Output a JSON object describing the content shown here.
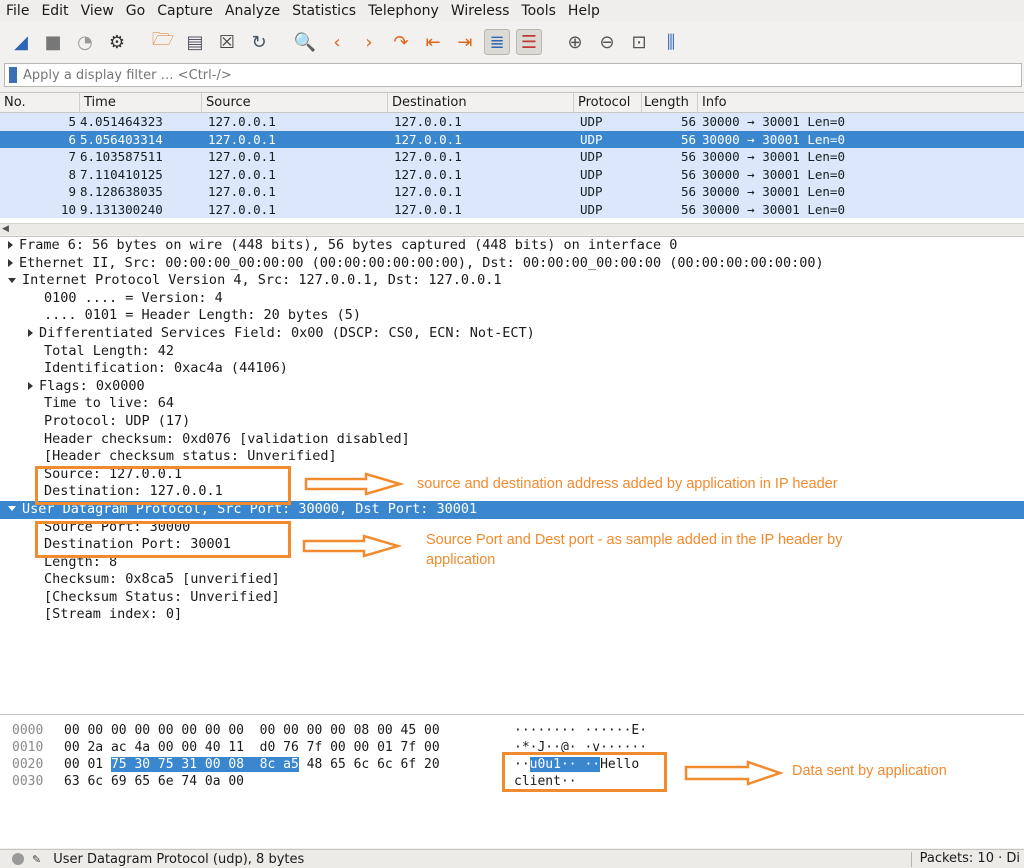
{
  "menu": [
    "File",
    "Edit",
    "View",
    "Go",
    "Capture",
    "Analyze",
    "Statistics",
    "Telephony",
    "Wireless",
    "Tools",
    "Help"
  ],
  "toolbar": [
    "shark-fin-start-icon",
    "stop-icon",
    "restart-icon",
    "options-gear-icon",
    "open-folder-icon",
    "save-file-icon",
    "close-file-icon",
    "reload-icon",
    "find-icon",
    "go-back-icon",
    "go-forward-icon",
    "go-to-packet-icon",
    "first-packet-icon",
    "last-packet-icon",
    "autoscroll-icon",
    "colorize-icon",
    "zoom-in-icon",
    "zoom-out-icon",
    "normal-size-icon",
    "resize-columns-icon"
  ],
  "filter": {
    "placeholder": "Apply a display filter … <Ctrl-/>"
  },
  "packet_list": {
    "columns": [
      "No.",
      "Time",
      "Source",
      "Destination",
      "Protocol",
      "Length",
      "Info"
    ],
    "rows": [
      {
        "no": "5",
        "time": "4.051464323",
        "src": "127.0.0.1",
        "dst": "127.0.0.1",
        "proto": "UDP",
        "len": "56",
        "info": "30000 → 30001 Len=0"
      },
      {
        "no": "6",
        "time": "5.056403314",
        "src": "127.0.0.1",
        "dst": "127.0.0.1",
        "proto": "UDP",
        "len": "56",
        "info": "30000 → 30001 Len=0"
      },
      {
        "no": "7",
        "time": "6.103587511",
        "src": "127.0.0.1",
        "dst": "127.0.0.1",
        "proto": "UDP",
        "len": "56",
        "info": "30000 → 30001 Len=0"
      },
      {
        "no": "8",
        "time": "7.110410125",
        "src": "127.0.0.1",
        "dst": "127.0.0.1",
        "proto": "UDP",
        "len": "56",
        "info": "30000 → 30001 Len=0"
      },
      {
        "no": "9",
        "time": "8.128638035",
        "src": "127.0.0.1",
        "dst": "127.0.0.1",
        "proto": "UDP",
        "len": "56",
        "info": "30000 → 30001 Len=0"
      },
      {
        "no": "10",
        "time": "9.131300240",
        "src": "127.0.0.1",
        "dst": "127.0.0.1",
        "proto": "UDP",
        "len": "56",
        "info": "30000 → 30001 Len=0"
      }
    ]
  },
  "details": [
    {
      "text": "Frame 6: 56 bytes on wire (448 bits), 56 bytes captured (448 bits) on interface 0",
      "indent": 0,
      "toggle": "collapsed"
    },
    {
      "text": "Ethernet II, Src: 00:00:00_00:00:00 (00:00:00:00:00:00), Dst: 00:00:00_00:00:00 (00:00:00:00:00:00)",
      "indent": 0,
      "toggle": "collapsed"
    },
    {
      "text": "Internet Protocol Version 4, Src: 127.0.0.1, Dst: 127.0.0.1",
      "indent": 0,
      "toggle": "expanded"
    },
    {
      "text": "0100 .... = Version: 4",
      "indent": 1,
      "toggle": "none"
    },
    {
      "text": ".... 0101 = Header Length: 20 bytes (5)",
      "indent": 1,
      "toggle": "none"
    },
    {
      "text": "Differentiated Services Field: 0x00 (DSCP: CS0, ECN: Not-ECT)",
      "indent": 1,
      "toggle": "collapsed"
    },
    {
      "text": "Total Length: 42",
      "indent": 1,
      "toggle": "none"
    },
    {
      "text": "Identification: 0xac4a (44106)",
      "indent": 1,
      "toggle": "none"
    },
    {
      "text": "Flags: 0x0000",
      "indent": 1,
      "toggle": "collapsed"
    },
    {
      "text": "Time to live: 64",
      "indent": 1,
      "toggle": "none"
    },
    {
      "text": "Protocol: UDP (17)",
      "indent": 1,
      "toggle": "none"
    },
    {
      "text": "Header checksum: 0xd076 [validation disabled]",
      "indent": 1,
      "toggle": "none"
    },
    {
      "text": "[Header checksum status: Unverified]",
      "indent": 1,
      "toggle": "none"
    },
    {
      "text": "Source: 127.0.0.1",
      "indent": 1,
      "toggle": "none"
    },
    {
      "text": "Destination: 127.0.0.1",
      "indent": 1,
      "toggle": "none"
    },
    {
      "text": "User Datagram Protocol, Src Port: 30000, Dst Port: 30001",
      "indent": 0,
      "toggle": "expanded",
      "selected": true
    },
    {
      "text": "Source Port: 30000",
      "indent": 1,
      "toggle": "none"
    },
    {
      "text": "Destination Port: 30001",
      "indent": 1,
      "toggle": "none"
    },
    {
      "text": "Length: 8",
      "indent": 1,
      "toggle": "none"
    },
    {
      "text": "Checksum: 0x8ca5 [unverified]",
      "indent": 1,
      "toggle": "none"
    },
    {
      "text": "[Checksum Status: Unverified]",
      "indent": 1,
      "toggle": "none"
    },
    {
      "text": "[Stream index: 0]",
      "indent": 1,
      "toggle": "none"
    }
  ],
  "hex": [
    {
      "offset": "0000",
      "pre": "00 00 00 00 00 00 00 00  00 00 00 00 08 00 45 00",
      "hl": "",
      "post": "",
      "ascii_pre": "········ ······E·",
      "ascii_hl": "",
      "ascii_post": ""
    },
    {
      "offset": "0010",
      "pre": "00 2a ac 4a 00 00 40 11  d0 76 7f 00 00 01 7f 00",
      "hl": "",
      "post": "",
      "ascii_pre": "·*·J··@· ·v······",
      "ascii_hl": "",
      "ascii_post": ""
    },
    {
      "offset": "0020",
      "pre": "00 01 ",
      "hl": "75 30 75 31 00 08  8c a5",
      "post": " 48 65 6c 6c 6f 20",
      "ascii_pre": "··",
      "ascii_hl": "u0u1·· ··",
      "ascii_post": "Hello "
    },
    {
      "offset": "0030",
      "pre": "63 6c 69 65 6e 74 0a 00",
      "hl": "",
      "post": "",
      "ascii_pre": "client··",
      "ascii_hl": "",
      "ascii_post": ""
    }
  ],
  "status": {
    "left": "User Datagram Protocol (udp), 8 bytes",
    "right": "Packets: 10 · Di"
  },
  "annotations": {
    "ip": "source and destination address added by application in IP header",
    "port": "Source Port and Dest port - as sample added in the IP header by application",
    "data": "Data sent by application",
    "color": "#f28a2e"
  }
}
